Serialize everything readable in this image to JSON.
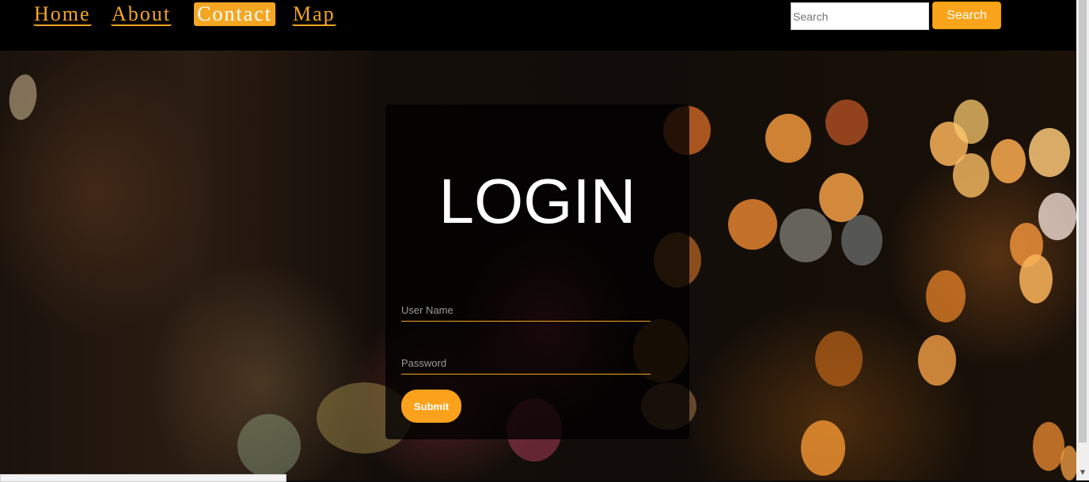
{
  "navbar": {
    "links": [
      {
        "label": "Home",
        "active": false
      },
      {
        "label": "About",
        "active": false
      },
      {
        "label": "Contact",
        "active": true
      },
      {
        "label": "Map",
        "active": false
      }
    ],
    "search": {
      "placeholder": "Search",
      "button_label": "Search"
    }
  },
  "login": {
    "title": "LOGIN",
    "username_placeholder": "User Name",
    "password_placeholder": "Password",
    "submit_label": "Submit"
  },
  "colors": {
    "accent": "#f4a623",
    "navbar": "#000000",
    "card": "rgba(0,0,0,0.78)"
  }
}
